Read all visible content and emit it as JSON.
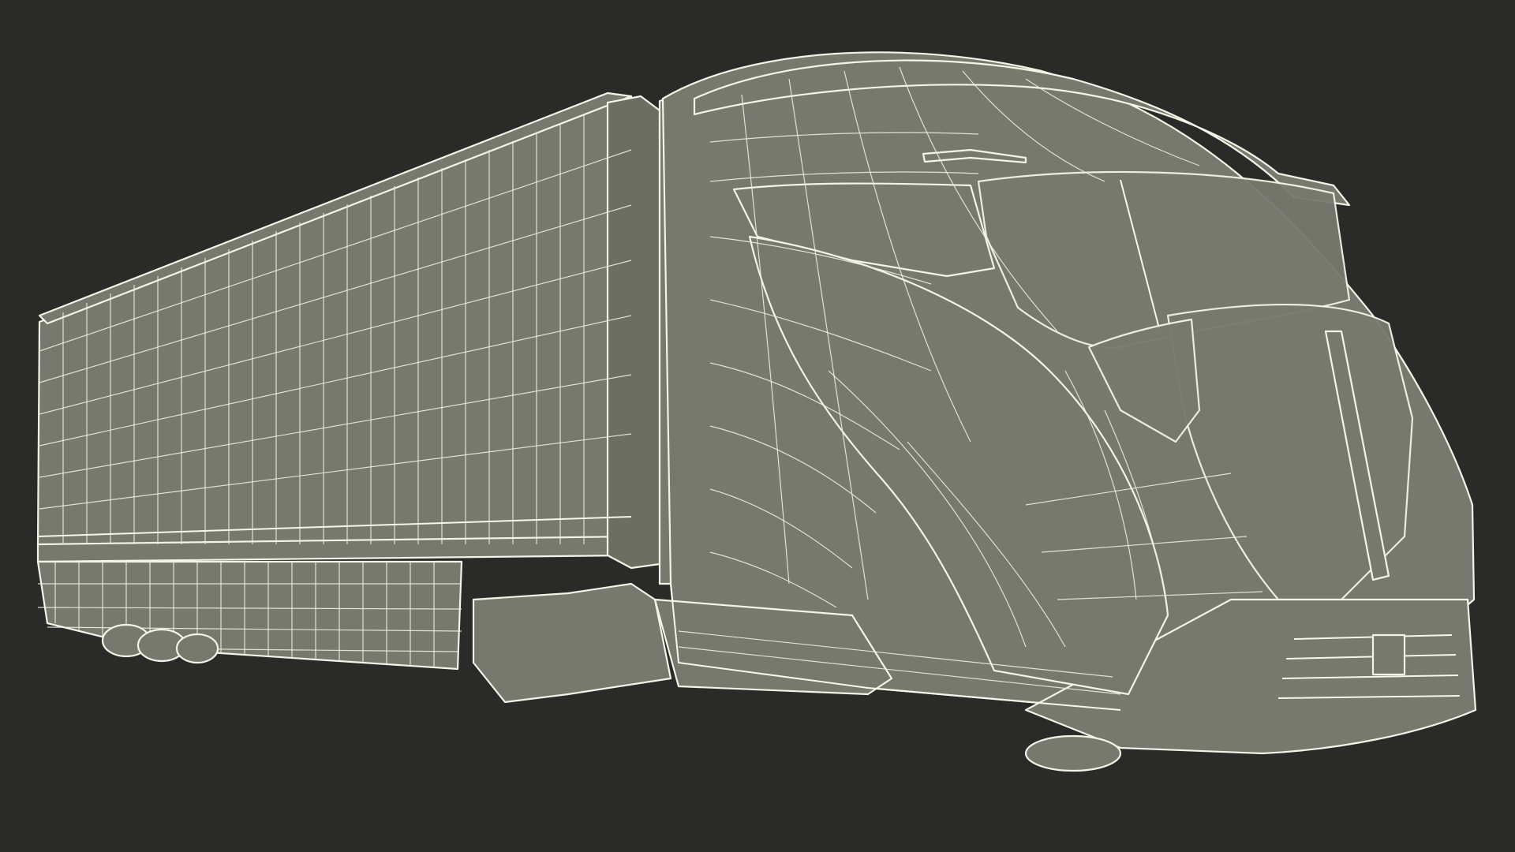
{
  "scene": {
    "subject": "wireframe-truck-with-trailer",
    "background_color": "#2a2a29",
    "surface_color": "#77786e",
    "wire_color": "#f3f3e6"
  }
}
